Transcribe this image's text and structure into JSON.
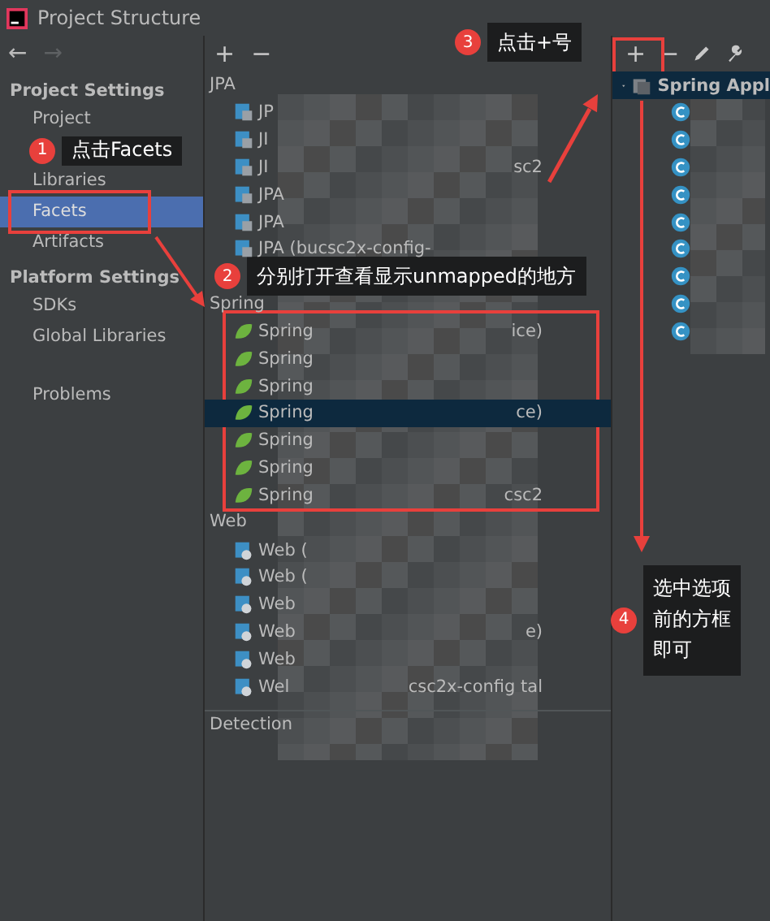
{
  "window": {
    "title": "Project Structure"
  },
  "sidebar": {
    "nav": [
      {
        "glyph": "←",
        "disabled": false
      },
      {
        "glyph": "→",
        "disabled": true
      }
    ],
    "items": [
      {
        "kind": "header",
        "label": "Project Settings"
      },
      {
        "kind": "item",
        "label": "Project",
        "selected": false
      },
      {
        "kind": "covered"
      },
      {
        "kind": "item",
        "label": "Libraries",
        "selected": false
      },
      {
        "kind": "item",
        "label": "Facets",
        "selected": true
      },
      {
        "kind": "item",
        "label": "Artifacts",
        "selected": false
      },
      {
        "kind": "header",
        "label": "Platform Settings"
      },
      {
        "kind": "item",
        "label": "SDKs",
        "selected": false
      },
      {
        "kind": "item",
        "label": "Global Libraries",
        "selected": false
      },
      {
        "kind": "gap"
      },
      {
        "kind": "item",
        "label": "Problems",
        "selected": false
      }
    ]
  },
  "facets": {
    "toolbar": [
      "+",
      "−"
    ],
    "groups": [
      {
        "name": "JPA",
        "items": [
          {
            "kind": "entry",
            "text": "JP",
            "selected": false
          },
          {
            "kind": "entry",
            "text": "JI",
            "selected": false
          },
          {
            "kind": "entry",
            "text": "JI",
            "tail": "sc2",
            "selected": false
          },
          {
            "kind": "entry",
            "text": "JPA",
            "selected": false
          },
          {
            "kind": "entry",
            "text": "JPA",
            "selected": false
          },
          {
            "kind": "entry",
            "text": "JPA (bucsc2x-config-",
            "selected": false
          },
          {
            "kind": "covered"
          }
        ]
      },
      {
        "name": "Spring",
        "items": [
          {
            "kind": "entry",
            "text": "Spring",
            "tail": "ice)",
            "selected": false
          },
          {
            "kind": "entry",
            "text": "Spring",
            "selected": false
          },
          {
            "kind": "entry",
            "text": "Spring",
            "selected": false
          },
          {
            "kind": "entry",
            "text": "Spring",
            "tail": "ce)",
            "selected": true
          },
          {
            "kind": "entry",
            "text": "Spring",
            "selected": false
          },
          {
            "kind": "entry",
            "text": "Spring",
            "selected": false
          },
          {
            "kind": "entry",
            "text": "Spring",
            "tail": "csc2",
            "selected": false
          }
        ]
      },
      {
        "name": "Web",
        "items": [
          {
            "kind": "entry",
            "text": "Web (",
            "selected": false
          },
          {
            "kind": "entry",
            "text": "Web (",
            "selected": false
          },
          {
            "kind": "entry",
            "text": "Web",
            "selected": false
          },
          {
            "kind": "entry",
            "text": "Web",
            "tail": "e)",
            "selected": false
          },
          {
            "kind": "entry",
            "text": "Web",
            "selected": false
          },
          {
            "kind": "entry",
            "text": "Wel",
            "tail": "csc2x-config   tal",
            "selected": false
          }
        ]
      }
    ],
    "detection": "Detection"
  },
  "details": {
    "toolbar": [
      {
        "kind": "glyph",
        "text": "+"
      },
      {
        "kind": "glyph",
        "text": "−"
      },
      {
        "kind": "pencil"
      },
      {
        "kind": "wrench"
      }
    ],
    "root": {
      "label": "Spring Appl",
      "expanded": true,
      "selected": true,
      "children": [
        {
          "kind": "class"
        },
        {
          "kind": "class"
        },
        {
          "kind": "class"
        },
        {
          "kind": "class"
        },
        {
          "kind": "class"
        },
        {
          "kind": "class"
        },
        {
          "kind": "class"
        },
        {
          "kind": "class"
        },
        {
          "kind": "class"
        }
      ]
    }
  },
  "annotations": [
    {
      "number": "3",
      "text": "点击+号",
      "kind": "plus"
    },
    {
      "number": "1",
      "text": "点击Facets",
      "kind": "facets"
    },
    {
      "number": "2",
      "text": "分别打开查看显示unmapped的地方",
      "kind": "spring"
    },
    {
      "number": "4",
      "text": "选中选项前的方框即可",
      "kind": "checkbox"
    }
  ]
}
